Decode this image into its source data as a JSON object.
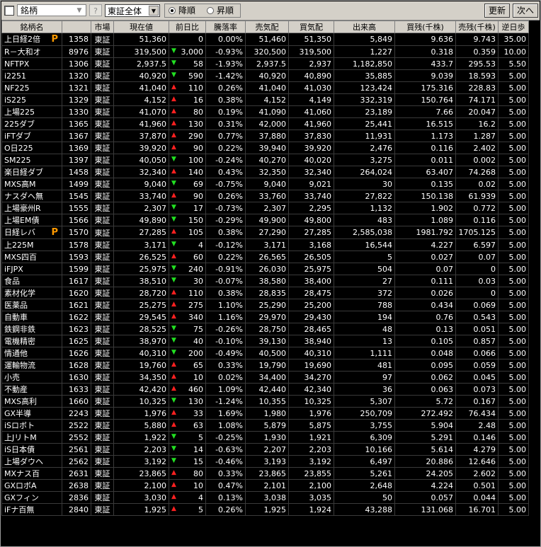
{
  "toolbar": {
    "symbol_combo": "銘柄",
    "help_label": "?",
    "market_select": "東証全体",
    "order_desc": "降順",
    "order_asc": "昇順",
    "refresh_label": "更新",
    "next_label": "次へ"
  },
  "columns": [
    "銘柄名",
    "コード",
    "市場",
    "現在値",
    "前日比",
    "騰落率",
    "売気配",
    "買気配",
    "出来高",
    "買残(千株)",
    "売残(千株)",
    "逆日歩"
  ],
  "colors": {
    "up": "#ff3030",
    "down": "#33ee33",
    "unchanged": "#ffff00",
    "premium_mark": "#ff9a00"
  },
  "rows": [
    {
      "name": "上日経2倍",
      "p": true,
      "code": "1358",
      "market": "東証",
      "price": "51,360",
      "dir": "none",
      "chg": "0",
      "rate": "0.00%",
      "ask": "51,460",
      "bid": "51,350",
      "vol": "5,849",
      "buyr": "9.636",
      "sellr": "9.743",
      "gyaku": "35.00"
    },
    {
      "name": "R－大和オ",
      "p": false,
      "code": "8976",
      "market": "東証",
      "price": "319,500",
      "dir": "dn",
      "chg": "3,000",
      "rate": "-0.93%",
      "ask": "320,500",
      "bid": "319,500",
      "vol": "1,227",
      "buyr": "0.318",
      "sellr": "0.359",
      "gyaku": "10.00"
    },
    {
      "name": "NFTPX",
      "p": false,
      "code": "1306",
      "market": "東証",
      "price": "2,937.5",
      "dir": "dn",
      "chg": "58",
      "rate": "-1.93%",
      "ask": "2,937.5",
      "bid": "2,937",
      "vol": "1,182,850",
      "buyr": "433.7",
      "sellr": "295.53",
      "gyaku": "5.50"
    },
    {
      "name": "i2251",
      "p": false,
      "code": "1320",
      "market": "東証",
      "price": "40,920",
      "dir": "dn",
      "chg": "590",
      "rate": "-1.42%",
      "ask": "40,920",
      "bid": "40,890",
      "vol": "35,885",
      "buyr": "9.039",
      "sellr": "18.593",
      "gyaku": "5.00"
    },
    {
      "name": "NF225",
      "p": false,
      "code": "1321",
      "market": "東証",
      "price": "41,040",
      "dir": "up",
      "chg": "110",
      "rate": "0.26%",
      "ask": "41,040",
      "bid": "41,030",
      "vol": "123,424",
      "buyr": "175.316",
      "sellr": "228.83",
      "gyaku": "5.00"
    },
    {
      "name": "iS225",
      "p": false,
      "code": "1329",
      "market": "東証",
      "price": "4,152",
      "dir": "up",
      "chg": "16",
      "rate": "0.38%",
      "ask": "4,152",
      "bid": "4,149",
      "vol": "332,319",
      "buyr": "150.764",
      "sellr": "74.171",
      "gyaku": "5.00"
    },
    {
      "name": "上場225",
      "p": false,
      "code": "1330",
      "market": "東証",
      "price": "41,070",
      "dir": "up",
      "chg": "80",
      "rate": "0.19%",
      "ask": "41,090",
      "bid": "41,060",
      "vol": "23,189",
      "buyr": "7.66",
      "sellr": "20.047",
      "gyaku": "5.00"
    },
    {
      "name": "225ダブ",
      "p": false,
      "code": "1365",
      "market": "東証",
      "price": "41,960",
      "dir": "up",
      "chg": "130",
      "rate": "0.31%",
      "ask": "42,000",
      "bid": "41,960",
      "vol": "25,441",
      "buyr": "16.515",
      "sellr": "16.2",
      "gyaku": "5.00"
    },
    {
      "name": "iFTダブ",
      "p": false,
      "code": "1367",
      "market": "東証",
      "price": "37,870",
      "dir": "up",
      "chg": "290",
      "rate": "0.77%",
      "ask": "37,880",
      "bid": "37,830",
      "vol": "11,931",
      "buyr": "1.173",
      "sellr": "1.287",
      "gyaku": "5.00"
    },
    {
      "name": "O日225",
      "p": false,
      "code": "1369",
      "market": "東証",
      "price": "39,920",
      "dir": "up",
      "chg": "90",
      "rate": "0.22%",
      "ask": "39,940",
      "bid": "39,920",
      "vol": "2,476",
      "buyr": "0.116",
      "sellr": "2.402",
      "gyaku": "5.00"
    },
    {
      "name": "SM225",
      "p": false,
      "code": "1397",
      "market": "東証",
      "price": "40,050",
      "dir": "dn",
      "chg": "100",
      "rate": "-0.24%",
      "ask": "40,270",
      "bid": "40,020",
      "vol": "3,275",
      "buyr": "0.011",
      "sellr": "0.002",
      "gyaku": "5.00"
    },
    {
      "name": "楽日経ダブ",
      "p": false,
      "code": "1458",
      "market": "東証",
      "price": "32,340",
      "dir": "up",
      "chg": "140",
      "rate": "0.43%",
      "ask": "32,350",
      "bid": "32,340",
      "vol": "264,024",
      "buyr": "63.407",
      "sellr": "74.268",
      "gyaku": "5.00"
    },
    {
      "name": "MXS高M",
      "p": false,
      "code": "1499",
      "market": "東証",
      "price": "9,040",
      "dir": "dn",
      "chg": "69",
      "rate": "-0.75%",
      "ask": "9,040",
      "bid": "9,021",
      "vol": "30",
      "buyr": "0.135",
      "sellr": "0.02",
      "gyaku": "5.00"
    },
    {
      "name": "ナスダヘ無",
      "p": false,
      "code": "1545",
      "market": "東証",
      "price": "33,740",
      "dir": "up",
      "chg": "90",
      "rate": "0.26%",
      "ask": "33,760",
      "bid": "33,740",
      "vol": "27,822",
      "buyr": "150.138",
      "sellr": "61.939",
      "gyaku": "5.00"
    },
    {
      "name": "上場豪州R",
      "p": false,
      "code": "1555",
      "market": "東証",
      "price": "2,307",
      "dir": "dn",
      "chg": "17",
      "rate": "-0.73%",
      "ask": "2,307",
      "bid": "2,295",
      "vol": "1,132",
      "buyr": "1.902",
      "sellr": "0.772",
      "gyaku": "5.00"
    },
    {
      "name": "上場EM債",
      "p": false,
      "code": "1566",
      "market": "東証",
      "price": "49,890",
      "dir": "dn",
      "chg": "150",
      "rate": "-0.29%",
      "ask": "49,900",
      "bid": "49,800",
      "vol": "483",
      "buyr": "1.089",
      "sellr": "0.116",
      "gyaku": "5.00"
    },
    {
      "name": "日経レバ",
      "p": true,
      "code": "1570",
      "market": "東証",
      "price": "27,285",
      "dir": "up",
      "chg": "105",
      "rate": "0.38%",
      "ask": "27,290",
      "bid": "27,285",
      "vol": "2,585,038",
      "buyr": "1981.792",
      "sellr": "1705.125",
      "gyaku": "5.00"
    },
    {
      "name": "上225M",
      "p": false,
      "code": "1578",
      "market": "東証",
      "price": "3,171",
      "dir": "dn",
      "chg": "4",
      "rate": "-0.12%",
      "ask": "3,171",
      "bid": "3,168",
      "vol": "16,544",
      "buyr": "4.227",
      "sellr": "6.597",
      "gyaku": "5.00"
    },
    {
      "name": "MXS四百",
      "p": false,
      "code": "1593",
      "market": "東証",
      "price": "26,525",
      "dir": "up",
      "chg": "60",
      "rate": "0.22%",
      "ask": "26,565",
      "bid": "26,505",
      "vol": "5",
      "buyr": "0.027",
      "sellr": "0.07",
      "gyaku": "5.00"
    },
    {
      "name": "iFJPX",
      "p": false,
      "code": "1599",
      "market": "東証",
      "price": "25,975",
      "dir": "dn",
      "chg": "240",
      "rate": "-0.91%",
      "ask": "26,030",
      "bid": "25,975",
      "vol": "504",
      "buyr": "0.07",
      "sellr": "0",
      "gyaku": "5.00"
    },
    {
      "name": "食品",
      "p": false,
      "code": "1617",
      "market": "東証",
      "price": "38,510",
      "dir": "dn",
      "chg": "30",
      "rate": "-0.07%",
      "ask": "38,580",
      "bid": "38,400",
      "vol": "27",
      "buyr": "0.111",
      "sellr": "0.03",
      "gyaku": "5.00"
    },
    {
      "name": "素材化学",
      "p": false,
      "code": "1620",
      "market": "東証",
      "price": "28,720",
      "dir": "up",
      "chg": "110",
      "rate": "0.38%",
      "ask": "28,835",
      "bid": "28,475",
      "vol": "372",
      "buyr": "0.026",
      "sellr": "0",
      "gyaku": "5.00"
    },
    {
      "name": "医薬品",
      "p": false,
      "code": "1621",
      "market": "東証",
      "price": "25,275",
      "dir": "up",
      "chg": "275",
      "rate": "1.10%",
      "ask": "25,290",
      "bid": "25,200",
      "vol": "788",
      "buyr": "0.434",
      "sellr": "0.069",
      "gyaku": "5.00"
    },
    {
      "name": "自動車",
      "p": false,
      "code": "1622",
      "market": "東証",
      "price": "29,545",
      "dir": "up",
      "chg": "340",
      "rate": "1.16%",
      "ask": "29,970",
      "bid": "29,430",
      "vol": "194",
      "buyr": "0.76",
      "sellr": "0.543",
      "gyaku": "5.00"
    },
    {
      "name": "鉄鋼非鉄",
      "p": false,
      "code": "1623",
      "market": "東証",
      "price": "28,525",
      "dir": "dn",
      "chg": "75",
      "rate": "-0.26%",
      "ask": "28,750",
      "bid": "28,465",
      "vol": "48",
      "buyr": "0.13",
      "sellr": "0.051",
      "gyaku": "5.00"
    },
    {
      "name": "電機精密",
      "p": false,
      "code": "1625",
      "market": "東証",
      "price": "38,970",
      "dir": "dn",
      "chg": "40",
      "rate": "-0.10%",
      "ask": "39,130",
      "bid": "38,940",
      "vol": "13",
      "buyr": "0.105",
      "sellr": "0.857",
      "gyaku": "5.00"
    },
    {
      "name": "情通他",
      "p": false,
      "code": "1626",
      "market": "東証",
      "price": "40,310",
      "dir": "dn",
      "chg": "200",
      "rate": "-0.49%",
      "ask": "40,500",
      "bid": "40,310",
      "vol": "1,111",
      "buyr": "0.048",
      "sellr": "0.066",
      "gyaku": "5.00"
    },
    {
      "name": "運輸物流",
      "p": false,
      "code": "1628",
      "market": "東証",
      "price": "19,760",
      "dir": "up",
      "chg": "65",
      "rate": "0.33%",
      "ask": "19,790",
      "bid": "19,690",
      "vol": "481",
      "buyr": "0.095",
      "sellr": "0.059",
      "gyaku": "5.00"
    },
    {
      "name": "小売",
      "p": false,
      "code": "1630",
      "market": "東証",
      "price": "34,350",
      "dir": "up",
      "chg": "10",
      "rate": "0.02%",
      "ask": "34,400",
      "bid": "34,270",
      "vol": "97",
      "buyr": "0.062",
      "sellr": "0.045",
      "gyaku": "5.00"
    },
    {
      "name": "不動産",
      "p": false,
      "code": "1633",
      "market": "東証",
      "price": "42,420",
      "dir": "up",
      "chg": "460",
      "rate": "1.09%",
      "ask": "42,440",
      "bid": "42,340",
      "vol": "36",
      "buyr": "0.063",
      "sellr": "0.073",
      "gyaku": "5.00"
    },
    {
      "name": "MXS高利",
      "p": false,
      "code": "1660",
      "market": "東証",
      "price": "10,325",
      "dir": "dn",
      "chg": "130",
      "rate": "-1.24%",
      "ask": "10,355",
      "bid": "10,325",
      "vol": "5,307",
      "buyr": "5.72",
      "sellr": "0.167",
      "gyaku": "5.00"
    },
    {
      "name": "GX半導",
      "p": false,
      "code": "2243",
      "market": "東証",
      "price": "1,976",
      "dir": "up",
      "chg": "33",
      "rate": "1.69%",
      "ask": "1,980",
      "bid": "1,976",
      "vol": "250,709",
      "buyr": "272.492",
      "sellr": "76.434",
      "gyaku": "5.00"
    },
    {
      "name": "iSロボト",
      "p": false,
      "code": "2522",
      "market": "東証",
      "price": "5,880",
      "dir": "up",
      "chg": "63",
      "rate": "1.08%",
      "ask": "5,879",
      "bid": "5,875",
      "vol": "3,755",
      "buyr": "5.904",
      "sellr": "2.48",
      "gyaku": "5.00"
    },
    {
      "name": "上JリトM",
      "p": false,
      "code": "2552",
      "market": "東証",
      "price": "1,922",
      "dir": "dn",
      "chg": "5",
      "rate": "-0.25%",
      "ask": "1,930",
      "bid": "1,921",
      "vol": "6,309",
      "buyr": "5.291",
      "sellr": "0.146",
      "gyaku": "5.00"
    },
    {
      "name": "iS日本債",
      "p": false,
      "code": "2561",
      "market": "東証",
      "price": "2,203",
      "dir": "dn",
      "chg": "14",
      "rate": "-0.63%",
      "ask": "2,207",
      "bid": "2,203",
      "vol": "10,166",
      "buyr": "5.614",
      "sellr": "4.279",
      "gyaku": "5.00"
    },
    {
      "name": "上場ダウヘ",
      "p": false,
      "code": "2562",
      "market": "東証",
      "price": "3,192",
      "dir": "dn",
      "chg": "15",
      "rate": "-0.46%",
      "ask": "3,193",
      "bid": "3,192",
      "vol": "6,497",
      "buyr": "20.886",
      "sellr": "12.646",
      "gyaku": "5.00"
    },
    {
      "name": "MXナス百",
      "p": false,
      "code": "2631",
      "market": "東証",
      "price": "23,865",
      "dir": "up",
      "chg": "80",
      "rate": "0.33%",
      "ask": "23,865",
      "bid": "23,855",
      "vol": "5,261",
      "buyr": "24.205",
      "sellr": "2.602",
      "gyaku": "5.00"
    },
    {
      "name": "GXロボA",
      "p": false,
      "code": "2638",
      "market": "東証",
      "price": "2,100",
      "dir": "up",
      "chg": "10",
      "rate": "0.47%",
      "ask": "2,101",
      "bid": "2,100",
      "vol": "2,648",
      "buyr": "4.224",
      "sellr": "0.501",
      "gyaku": "5.00"
    },
    {
      "name": "GXフィン",
      "p": false,
      "code": "2836",
      "market": "東証",
      "price": "3,030",
      "dir": "up",
      "chg": "4",
      "rate": "0.13%",
      "ask": "3,038",
      "bid": "3,035",
      "vol": "50",
      "buyr": "0.057",
      "sellr": "0.044",
      "gyaku": "5.00"
    },
    {
      "name": "iFナ百無",
      "p": false,
      "code": "2840",
      "market": "東証",
      "price": "1,925",
      "dir": "up",
      "chg": "5",
      "rate": "0.26%",
      "ask": "1,925",
      "bid": "1,924",
      "vol": "43,288",
      "buyr": "131.068",
      "sellr": "16.701",
      "gyaku": "5.00"
    }
  ]
}
